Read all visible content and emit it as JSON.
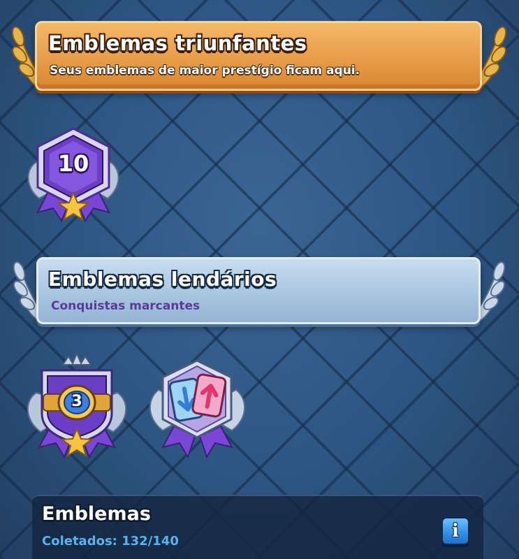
{
  "triumph_section": {
    "title": "Emblemas triunfantes",
    "subtitle": "Seus emblemas de maior prestígio ficam aqui.",
    "badges": [
      {
        "icon": "hexagon-level-badge-icon",
        "label": "10"
      }
    ]
  },
  "legendary_section": {
    "title": "Emblemas lendários",
    "subtitle": "Conquistas marcantes",
    "badges": [
      {
        "icon": "championship-belt-badge-icon",
        "label": "3"
      },
      {
        "icon": "card-swap-badge-icon"
      }
    ]
  },
  "footer": {
    "title": "Emblemas",
    "collected_text": "Coletados: 132/140",
    "collected": 132,
    "total": 140,
    "info_icon": "info-icon",
    "info_label": "i"
  },
  "colors": {
    "background": "#2c4f77",
    "triumph_banner": "#e89d48",
    "legendary_banner": "#a9c6e0",
    "legendary_subtitle": "#5a3a99",
    "badge_purple": "#6a3fc4",
    "collected_text": "#58b4f0",
    "info_button": "#2f8ee8"
  }
}
